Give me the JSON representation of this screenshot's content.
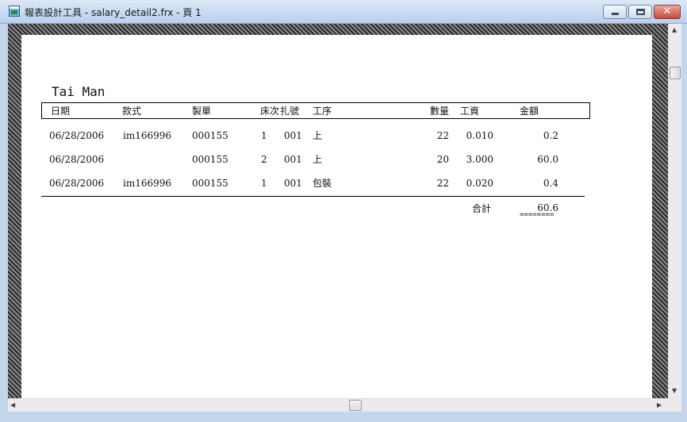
{
  "window": {
    "title": "報表設計工具 - salary_detail2.frx - 頁 1",
    "minimize_icon": "minimize-icon",
    "maximize_icon": "maximize-icon",
    "close_glyph": "✕"
  },
  "report": {
    "name": "Tai Man",
    "columns": [
      "日期",
      "款式",
      "製單",
      "床次",
      "扎號",
      "工序",
      "數量",
      "工資",
      "金額"
    ],
    "rows": [
      {
        "date": "06/28/2006",
        "style": "im166996",
        "order": "000155",
        "bed": "1",
        "bundle": "001",
        "process": "上",
        "qty": "22",
        "wage": "0.010",
        "amount": "0.2"
      },
      {
        "date": "06/28/2006",
        "style": "",
        "order": "000155",
        "bed": "2",
        "bundle": "001",
        "process": "上",
        "qty": "20",
        "wage": "3.000",
        "amount": "60.0"
      },
      {
        "date": "06/28/2006",
        "style": "im166996",
        "order": "000155",
        "bed": "1",
        "bundle": "001",
        "process": "包裝",
        "qty": "22",
        "wage": "0.020",
        "amount": "0.4"
      }
    ],
    "total_label": "合計",
    "total_value": "60.6",
    "total_underline": "========"
  },
  "scrollbars": {
    "up_arrow": "▲",
    "down_arrow": "▼",
    "left_arrow": "◀",
    "right_arrow": "▶"
  }
}
